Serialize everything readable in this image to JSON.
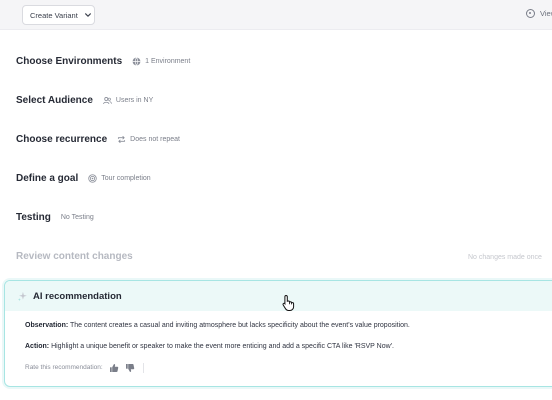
{
  "topbar": {
    "create_variant_label": "Create Variant",
    "view_label": "View"
  },
  "sections": [
    {
      "title": "Choose Environments",
      "meta": "1 Environment",
      "icon": "globe-icon"
    },
    {
      "title": "Select Audience",
      "meta": "Users in NY",
      "icon": "users-icon"
    },
    {
      "title": "Choose recurrence",
      "meta": "Does not repeat",
      "icon": "repeat-icon"
    },
    {
      "title": "Define a goal",
      "meta": "Tour completion",
      "icon": "target-icon"
    },
    {
      "title": "Testing",
      "meta": "No Testing",
      "icon": ""
    },
    {
      "title": "Review content changes",
      "meta": "No changes made once",
      "icon": "",
      "disabled": true
    }
  ],
  "ai": {
    "title": "AI recommendation",
    "observation_label": "Observation:",
    "observation_text": "The content creates a casual and inviting atmosphere but lacks specificity about the event's value proposition.",
    "action_label": "Action:",
    "action_text": "Highlight a unique benefit or speaker to make the event more enticing and add a specific CTA like 'RSVP Now'.",
    "rate_label": "Rate this recommendation:"
  },
  "colors": {
    "accent_border": "#a7e5e3",
    "accent_bg": "#ecf9f8"
  }
}
